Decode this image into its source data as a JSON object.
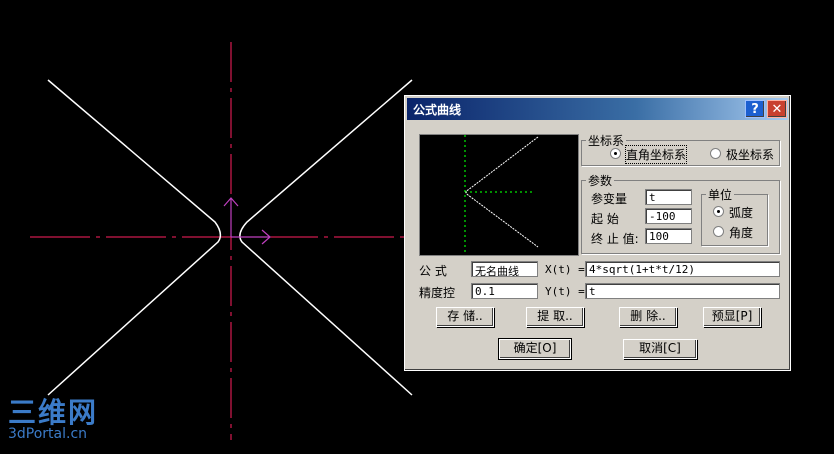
{
  "dialog": {
    "title": "公式曲线",
    "help_label": "?",
    "close_label": "✕",
    "coord_group": {
      "legend": "坐标系",
      "options": [
        {
          "label": "直角坐标系",
          "selected": true
        },
        {
          "label": "极坐标系",
          "selected": false
        }
      ]
    },
    "param_group": {
      "legend": "参数",
      "variable_label": "参变量",
      "variable_value": "t",
      "start_label": "起 始",
      "start_value": "-100",
      "end_label": "终 止 值:",
      "end_value": "100",
      "unit_group": {
        "legend": "单位",
        "options": [
          {
            "label": "弧度",
            "selected": true
          },
          {
            "label": "角度",
            "selected": false
          }
        ]
      }
    },
    "formula_label": "公 式",
    "formula_name": "无名曲线",
    "x_label": "X(t) =",
    "x_expr": "4*sqrt(1+t*t/12)",
    "precision_label": "精度控",
    "precision_value": "0.1",
    "y_label": "Y(t) =",
    "y_expr": "t",
    "buttons": {
      "save": "存 储..",
      "extract": "提 取..",
      "delete": "删 除..",
      "preview": "预显[P]",
      "ok": "确定[O]",
      "cancel": "取消[C]"
    }
  },
  "watermark": {
    "main": "三维网",
    "sub": "3dPortal.cn"
  },
  "colors": {
    "canvas_bg": "#000000",
    "axis": "#ff2060",
    "curve": "#ffffff",
    "ucs": "#c040c0",
    "dialog_bg": "#d4d0c8",
    "watermark": "#3b7bc8"
  }
}
